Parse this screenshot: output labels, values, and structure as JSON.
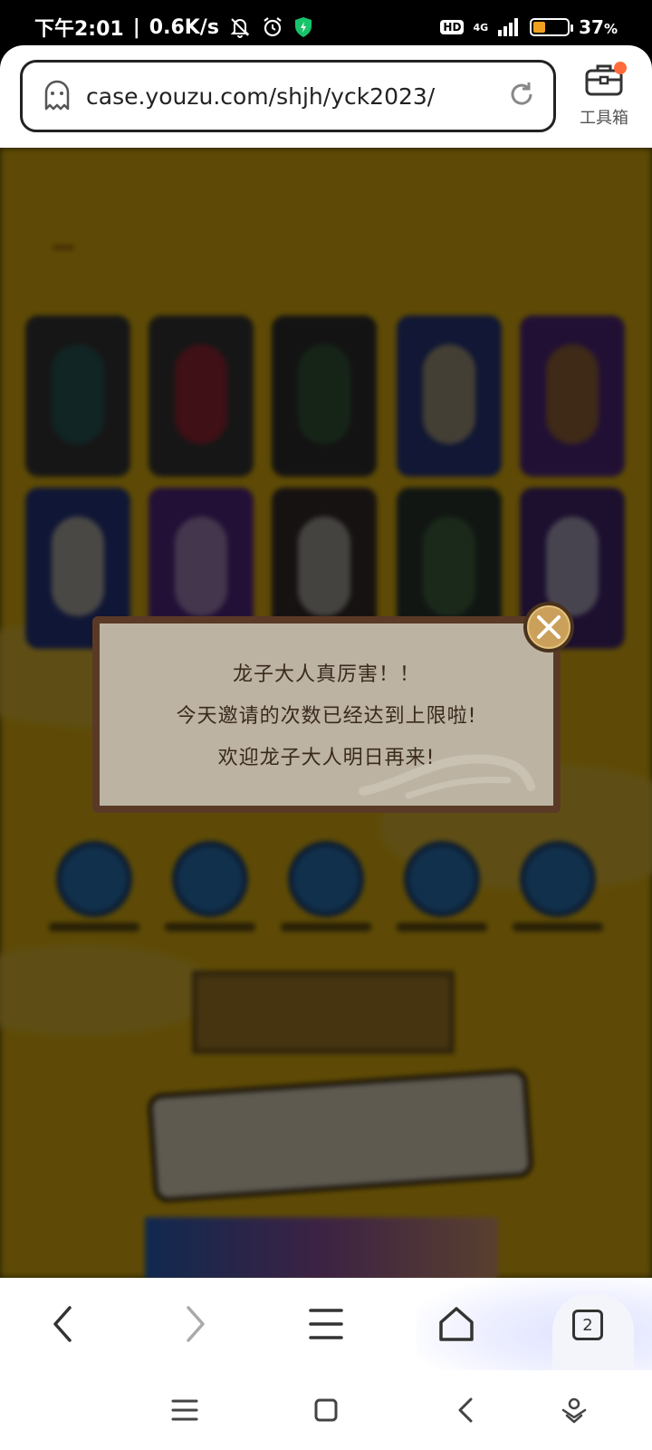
{
  "status_bar": {
    "time": "下午2:01",
    "separator": "|",
    "net_speed": "0.6K/s",
    "hd": "HD",
    "network": "4G",
    "battery_percent": "37",
    "battery_unit": "%",
    "battery_level": 0.37,
    "battery_color": "#f0a020",
    "icons": [
      "mute-bell-icon",
      "alarm-icon",
      "shield-icon",
      "signal-icon",
      "battery-icon"
    ]
  },
  "browser": {
    "url": "case.youzu.com/shjh/yck2023/",
    "toolbox_label": "工具箱",
    "tab_count": "2"
  },
  "dialog": {
    "lines": [
      "龙子大人真厉害！！",
      "今天邀请的次数已经达到上限啦!",
      "欢迎龙子大人明日再来!"
    ]
  },
  "bottom_nav": [
    "back-icon",
    "forward-icon",
    "menu-icon",
    "home-icon",
    "tabs-icon"
  ],
  "system_nav": [
    "menu-icon",
    "home-square-icon",
    "back-icon",
    "assistant-icon"
  ]
}
